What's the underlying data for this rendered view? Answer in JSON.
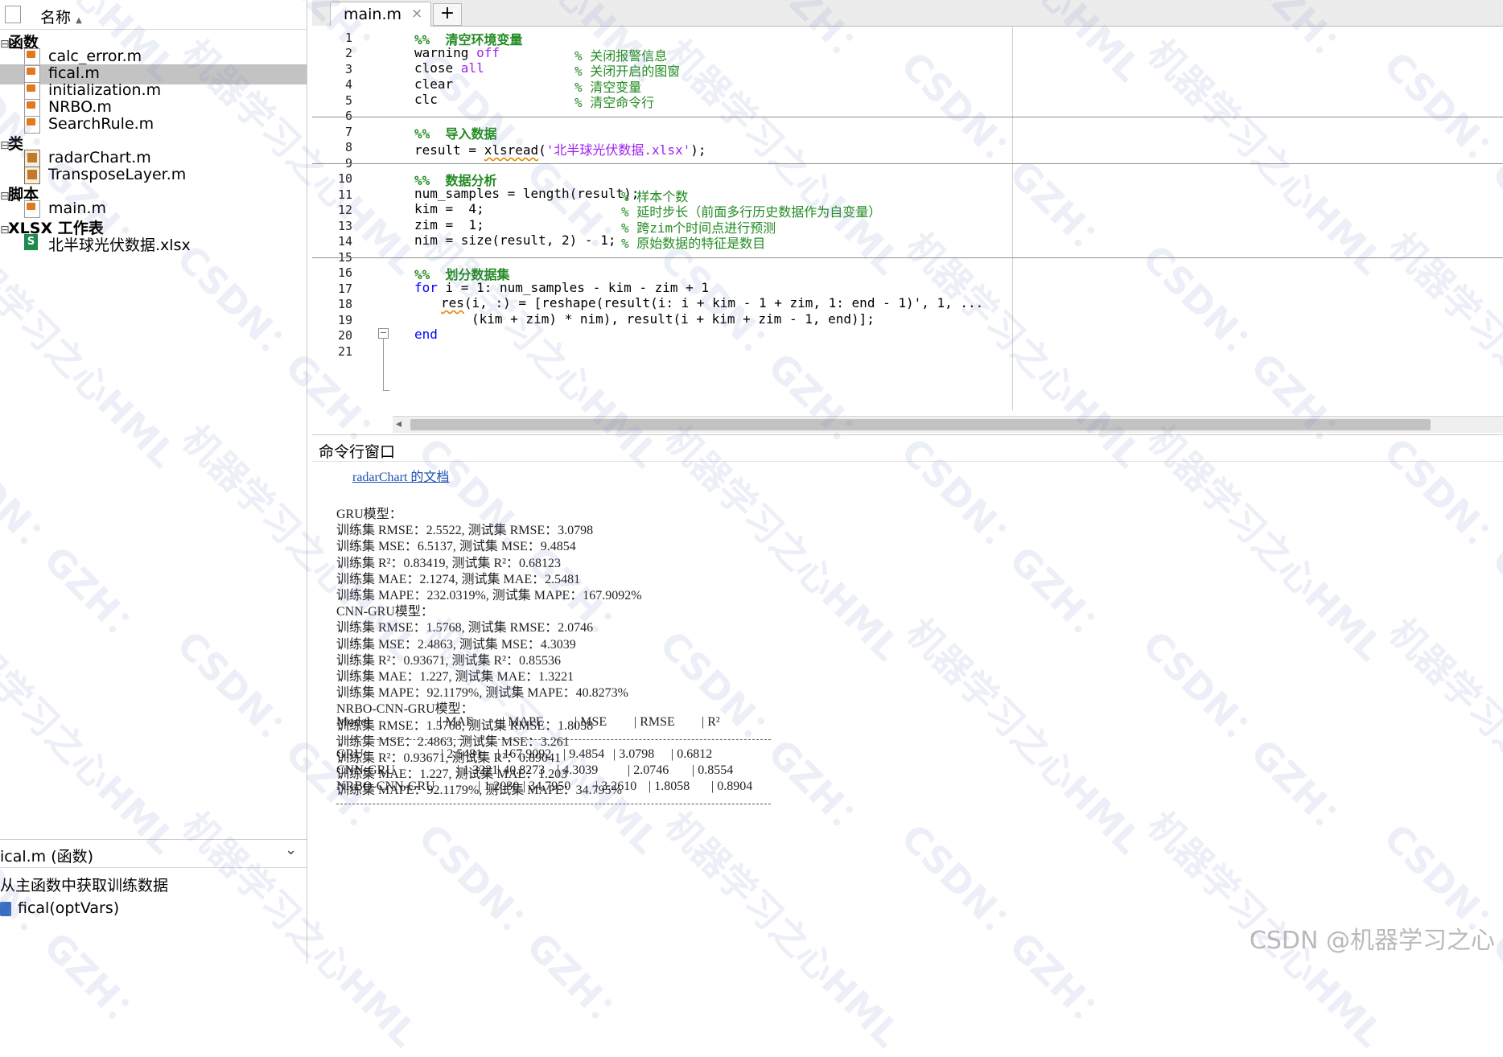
{
  "file_browser": {
    "header_label": "名称",
    "categories": {
      "functions": "函数",
      "classes": "类",
      "scripts": "脚本",
      "xlsx": "XLSX 工作表"
    },
    "files": {
      "calc_error": "calc_error.m",
      "fical": "fical.m",
      "initialization": "initialization.m",
      "nrbo": "NRBO.m",
      "searchrule": "SearchRule.m",
      "radarchart": "radarChart.m",
      "transposelayer": "TransposeLayer.m",
      "main": "main.m",
      "xlsx": "北半球光伏数据.xlsx"
    },
    "detail": {
      "selected": "ical.m (函数)",
      "description": "从主函数中获取训练数据",
      "signature": "fical(optVars)"
    }
  },
  "editor": {
    "tab_label": "main.m",
    "tab_close": "×",
    "tab_add": "+",
    "line_numbers": [
      "1",
      "2",
      "3",
      "4",
      "5",
      "6",
      "7",
      "8",
      "9",
      "10",
      "11",
      "12",
      "13",
      "14",
      "15",
      "16",
      "17",
      "18",
      "19",
      "20",
      "21"
    ],
    "code": {
      "l1": "%%  清空环境变量",
      "l2_a": "warning ",
      "l2_b": "off",
      "l2_c": "% 关闭报警信息",
      "l3_a": "close ",
      "l3_b": "all",
      "l3_c": "% 关闭开启的图窗",
      "l4_a": "clear",
      "l4_c": "% 清空变量",
      "l5_a": "clc",
      "l5_c": "% 清空命令行",
      "l7": "%%  导入数据",
      "l8_a": "result = ",
      "l8_b": "xlsread",
      "l8_c": "(",
      "l8_d": "'北半球光伏数据.xlsx'",
      "l8_e": ");",
      "l10": "%%  数据分析",
      "l11_a": "num_samples = length(result);",
      "l11_c": "% 样本个数",
      "l12_a": "kim =  4;",
      "l12_c": "% 延时步长（前面多行历史数据作为自变量）",
      "l13_a": "zim =  1;",
      "l13_c": "% 跨zim个时间点进行预测",
      "l14_a": "nim = size(result, 2) - 1;",
      "l14_c": "% 原始数据的特征是数目",
      "l16": "%%  划分数据集",
      "l17_a": "for",
      "l17_b": " i = 1: num_samples - kim - zim + 1",
      "l18_a": "res",
      "l18_b": "(i, :) = [reshape(result(i: i + kim - 1 + zim, 1: end - 1)', 1, ...",
      "l19": "(kim + zim) * nim), result(i + kim + zim - 1, end)];",
      "l20": "end"
    }
  },
  "command_window": {
    "title": "命令行窗口",
    "link": "radarChart 的文档",
    "lines": [
      "GRU模型：",
      "训练集 RMSE：2.5522, 测试集 RMSE：3.0798",
      "训练集 MSE：6.5137, 测试集 MSE：9.4854",
      "训练集 R²：0.83419, 测试集 R²：0.68123",
      "训练集 MAE：2.1274, 测试集 MAE：2.5481",
      "训练集 MAPE：232.0319%, 测试集 MAPE：167.9092%",
      "CNN-GRU模型：",
      "训练集 RMSE：1.5768, 测试集 RMSE：2.0746",
      "训练集 MSE：2.4863, 测试集 MSE：4.3039",
      "训练集 R²：0.93671, 测试集 R²：0.85536",
      "训练集 MAE：1.227, 测试集 MAE：1.3221",
      "训练集 MAPE：92.1179%, 测试集 MAPE：40.8273%",
      "NRBO-CNN-GRU模型：",
      "训练集 RMSE：1.5768, 测试集 RMSE：1.8058",
      "训练集 MSE：2.4863, 测试集 MSE：3.261",
      "训练集 R²：0.93671, 测试集 R²：0.89041",
      "训练集 MAE：1.227, 测试集 MAE：1.203",
      "训练集 MAPE：92.1179%, 测试集 MAPE：34.795%"
    ],
    "table": {
      "headers": [
        "Model",
        "| MAE",
        "| MAPE",
        "| MSE",
        "| RMSE",
        "| R²"
      ],
      "rows": [
        [
          "GRU",
          "| 2.5481",
          "| 167.9092",
          "| 9.4854",
          "| 3.0798",
          "| 0.6812"
        ],
        [
          "CNN-GRU",
          "| 1.3221",
          "| 40.8273",
          "| 4.3039",
          "| 2.0746",
          "| 0.8554"
        ],
        [
          "NRBO-CNN-GRU",
          "| 1.2030",
          "| 34.7950",
          "| 3.2610",
          "| 1.8058",
          "| 0.8904"
        ]
      ]
    }
  },
  "watermark": {
    "corner": "CSDN @机器学习之心",
    "tile_a": "机器学习之心HML",
    "tile_b": "CSDN：GZH："
  },
  "colors": {
    "keyword": "#0000ff",
    "string": "#a020f0",
    "comment": "#228b22",
    "selection": "#c3c3c3"
  }
}
